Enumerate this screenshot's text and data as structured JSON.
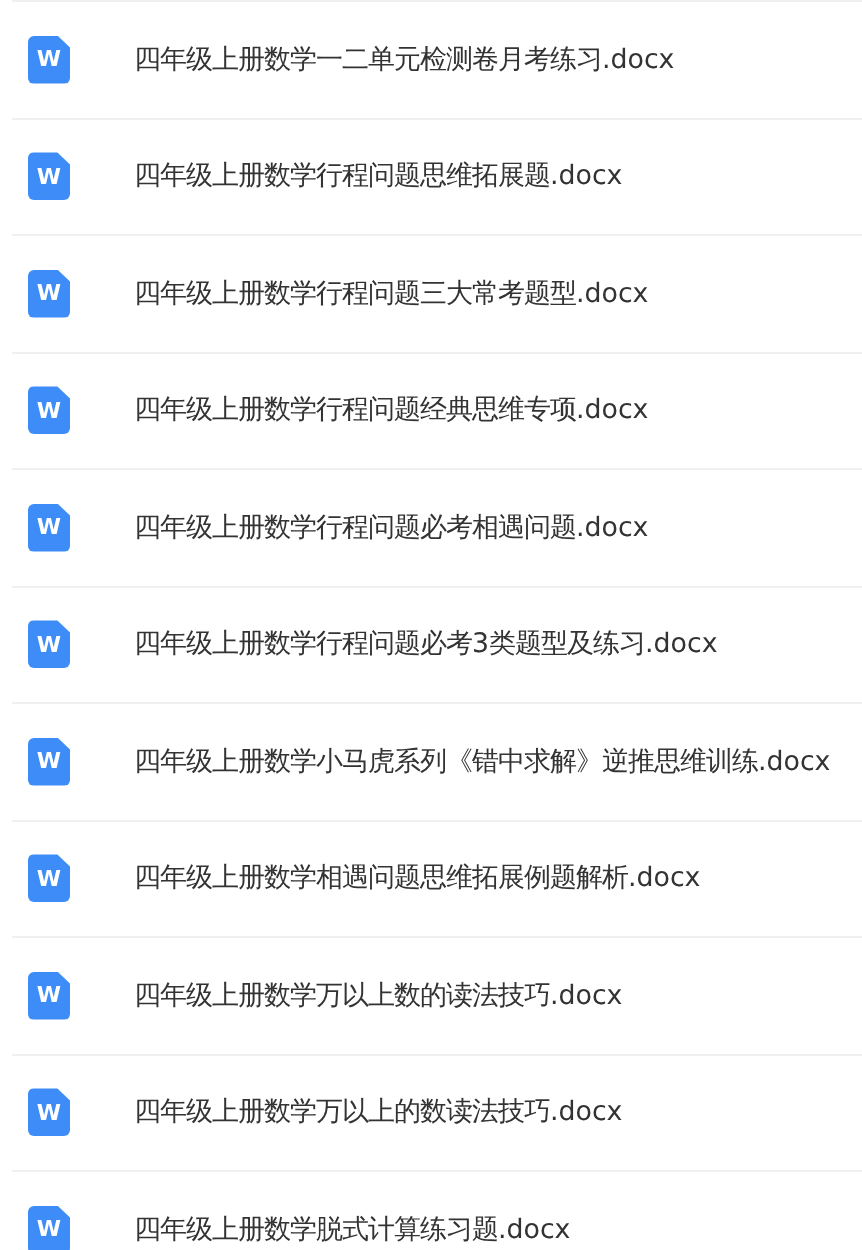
{
  "files": [
    {
      "icon_letter": "W",
      "name": "四年级上册数学一二单元检测卷月考练习.docx"
    },
    {
      "icon_letter": "W",
      "name": "四年级上册数学行程问题思维拓展题.docx"
    },
    {
      "icon_letter": "W",
      "name": "四年级上册数学行程问题三大常考题型.docx"
    },
    {
      "icon_letter": "W",
      "name": "四年级上册数学行程问题经典思维专项.docx"
    },
    {
      "icon_letter": "W",
      "name": "四年级上册数学行程问题必考相遇问题.docx"
    },
    {
      "icon_letter": "W",
      "name": "四年级上册数学行程问题必考3类题型及练习.docx"
    },
    {
      "icon_letter": "W",
      "name": "四年级上册数学小马虎系列《错中求解》逆推思维训练.docx"
    },
    {
      "icon_letter": "W",
      "name": "四年级上册数学相遇问题思维拓展例题解析.docx"
    },
    {
      "icon_letter": "W",
      "name": "四年级上册数学万以上数的读法技巧.docx"
    },
    {
      "icon_letter": "W",
      "name": "四年级上册数学万以上的数读法技巧.docx"
    },
    {
      "icon_letter": "W",
      "name": "四年级上册数学脱式计算练习题.docx"
    }
  ]
}
